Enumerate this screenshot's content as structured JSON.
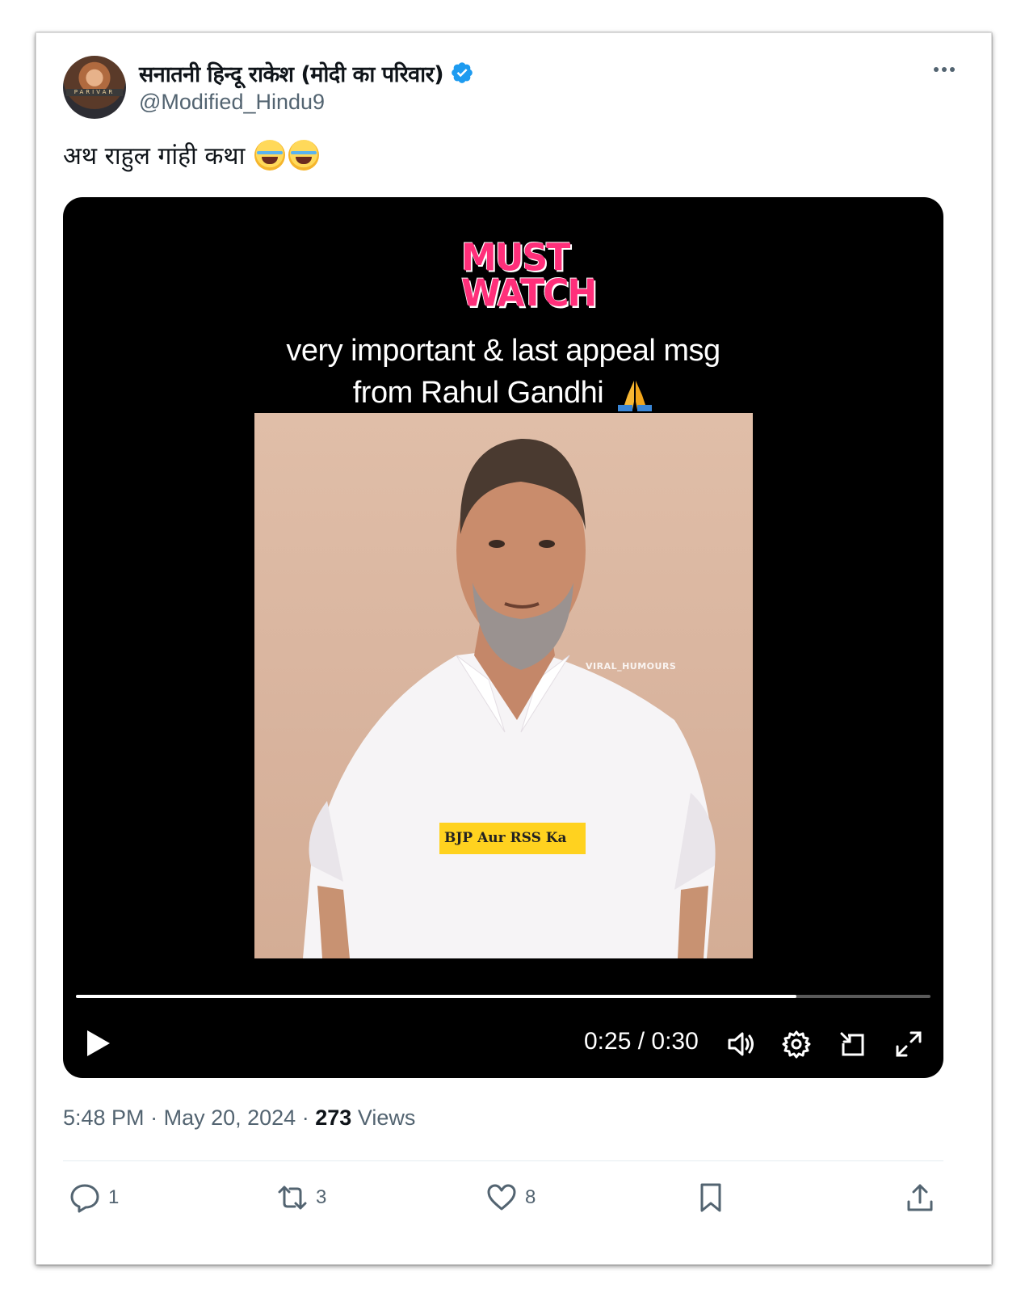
{
  "tweet": {
    "display_name": "सनातनी हिन्दू राकेश (मोदी का परिवार)",
    "handle": "@Modified_Hindu9",
    "avatar_ribbon": "PARIVAR",
    "text": "अथ राहुल गांही कथा",
    "emojis": [
      "face-with-tears-of-joy",
      "face-with-tears-of-joy"
    ]
  },
  "video": {
    "badge_line1": "MUST",
    "badge_line2": "WATCH",
    "headline_line1": "very important & last appeal msg",
    "headline_line2": "from Rahul Gandhi",
    "headline_emoji": "folded-hands",
    "watermark": "VIRAL_HUMOURS",
    "caption": "BJP Aur RSS Ka",
    "progress": 0.843,
    "time": "0:25 / 0:30",
    "controls": [
      "play-icon",
      "volume-icon",
      "settings-gear-icon",
      "pip-icon",
      "fullscreen-icon"
    ]
  },
  "meta": {
    "time": "5:48 PM",
    "separator": "·",
    "date": "May 20, 2024",
    "views_count": "273",
    "views_label": "Views"
  },
  "actions": {
    "replies": "1",
    "retweets": "3",
    "likes": "8"
  },
  "colors": {
    "verified": "#1d9bf0",
    "secondary_text": "#536471",
    "must_watch": "#ff2f7a",
    "caption_bg": "#ffd21f"
  }
}
